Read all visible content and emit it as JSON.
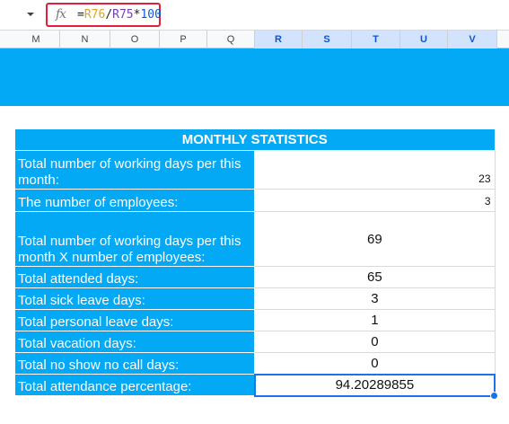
{
  "formula_bar": {
    "fx_icon": "fx",
    "formula_parts": [
      "=",
      "R76",
      "/",
      "R75",
      "*",
      "100"
    ]
  },
  "columns": [
    "M",
    "N",
    "O",
    "P",
    "Q",
    "R",
    "S",
    "T",
    "U",
    "V"
  ],
  "selected_columns": [
    "R",
    "S",
    "T",
    "U",
    "V"
  ],
  "stats": {
    "title": "MONTHLY STATISTICS",
    "rows": [
      {
        "label": "Total number of working days per this month:",
        "value": "23"
      },
      {
        "label": "The number of employees:",
        "value": "3"
      },
      {
        "label": "Total number of working days per this month X number of employees:",
        "value": "69"
      },
      {
        "label": "Total attended days:",
        "value": "65"
      },
      {
        "label": "Total sick leave days:",
        "value": "3"
      },
      {
        "label": "Total personal leave days:",
        "value": "1"
      },
      {
        "label": "Total vacation days:",
        "value": "0"
      },
      {
        "label": "Total no show no call days:",
        "value": "0"
      },
      {
        "label": "Total attendance percentage:",
        "value": "94.20289855"
      }
    ]
  },
  "colors": {
    "accent_blue": "#03a9f4",
    "formula_border": "#e3203c",
    "selection": "#1a73e8"
  }
}
